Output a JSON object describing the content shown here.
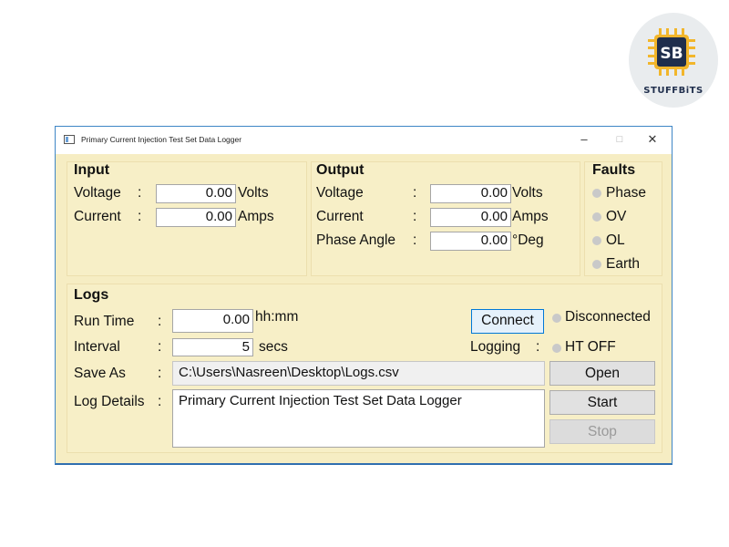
{
  "logo": {
    "brand": "STUFFBiTS",
    "mark": "SB",
    "colors": {
      "navy": "#1f2e4c",
      "gold": "#f2b62b"
    }
  },
  "window": {
    "title": "Primary Current Injection Test Set Data Logger",
    "controls": {
      "minimize": "–",
      "maximize": "□",
      "close": "✕"
    }
  },
  "input": {
    "header": "Input",
    "voltage": {
      "label": "Voltage",
      "sep": ":",
      "value": "0.00",
      "unit": "Volts"
    },
    "current": {
      "label": "Current",
      "sep": ":",
      "value": "0.00",
      "unit": "Amps"
    }
  },
  "output": {
    "header": "Output",
    "voltage": {
      "label": "Voltage",
      "sep": ":",
      "value": "0.00",
      "unit": "Volts"
    },
    "current": {
      "label": "Current",
      "sep": ":",
      "value": "0.00",
      "unit": "Amps"
    },
    "phase": {
      "label": "Phase Angle",
      "sep": ":",
      "value": "0.00",
      "unit": "°Deg"
    }
  },
  "faults": {
    "header": "Faults",
    "items": [
      "Phase",
      "OV",
      "OL",
      "Earth"
    ],
    "led_color": "#c9c9c9"
  },
  "logs": {
    "header": "Logs",
    "run_time": {
      "label": "Run Time",
      "sep": ":",
      "value": "0.00",
      "unit": "hh:mm"
    },
    "interval": {
      "label": "Interval",
      "sep": ":",
      "value": "5",
      "unit": "secs"
    },
    "save_as": {
      "label": "Save As",
      "sep": ":",
      "value": "C:\\Users\\Nasreen\\Desktop\\Logs.csv"
    },
    "details": {
      "label": "Log Details",
      "sep": ":",
      "value": "Primary Current Injection Test Set Data Logger"
    },
    "connect": "Connect",
    "connection_status": "Disconnected",
    "logging": {
      "label": "Logging",
      "sep": ":",
      "status": "HT OFF"
    },
    "open": "Open",
    "start": "Start",
    "stop": "Stop"
  }
}
